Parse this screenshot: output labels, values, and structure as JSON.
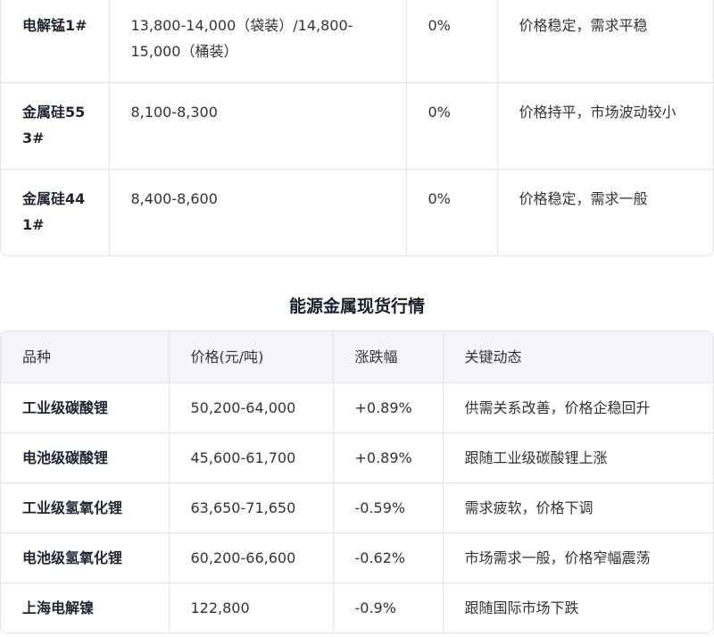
{
  "table_top": {
    "rows": [
      {
        "name": "电解锰1#",
        "price": "13,800-14,000（袋装）/14,800-15,000（桶装）",
        "change": "0%",
        "note": "价格稳定，需求平稳"
      },
      {
        "name": "金属硅553#",
        "price": "8,100-8,300",
        "change": "0%",
        "note": "价格持平，市场波动较小"
      },
      {
        "name": "金属硅441#",
        "price": "8,400-8,600",
        "change": "0%",
        "note": "价格稳定，需求一般"
      }
    ]
  },
  "energy": {
    "title": "能源金属现货行情",
    "headers": [
      "品种",
      "价格(元/吨)",
      "涨跌幅",
      "关键动态"
    ],
    "rows": [
      {
        "name": "工业级碳酸锂",
        "price": "50,200-64,000",
        "change": "+0.89%",
        "note": "供需关系改善，价格企稳回升"
      },
      {
        "name": "电池级碳酸锂",
        "price": "45,600-61,700",
        "change": "+0.89%",
        "note": "跟随工业级碳酸锂上涨"
      },
      {
        "name": "工业级氢氧化锂",
        "price": "63,650-71,650",
        "change": "-0.59%",
        "note": "需求疲软，价格下调"
      },
      {
        "name": "电池级氢氧化锂",
        "price": "60,200-66,600",
        "change": "-0.62%",
        "note": "市场需求一般，价格窄幅震荡"
      },
      {
        "name": "上海电解镍",
        "price": "122,800",
        "change": "-0.9%",
        "note": "跟随国际市场下跌"
      }
    ]
  }
}
